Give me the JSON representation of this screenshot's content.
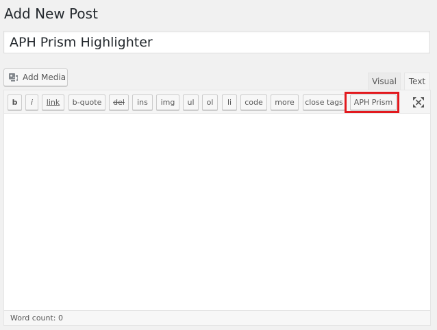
{
  "page": {
    "title": "Add New Post"
  },
  "post": {
    "title_value": "APH Prism Highlighter"
  },
  "media": {
    "add_label": "Add Media",
    "icon": "media-icon"
  },
  "editor_tabs": {
    "visual_label": "Visual",
    "text_label": "Text",
    "active": "Text"
  },
  "quicktags": [
    {
      "id": "b",
      "label": "b"
    },
    {
      "id": "i",
      "label": "i"
    },
    {
      "id": "link",
      "label": "link"
    },
    {
      "id": "b-quote",
      "label": "b-quote"
    },
    {
      "id": "del",
      "label": "del"
    },
    {
      "id": "ins",
      "label": "ins"
    },
    {
      "id": "img",
      "label": "img"
    },
    {
      "id": "ul",
      "label": "ul"
    },
    {
      "id": "ol",
      "label": "ol"
    },
    {
      "id": "li",
      "label": "li"
    },
    {
      "id": "code",
      "label": "code"
    },
    {
      "id": "more",
      "label": "more"
    },
    {
      "id": "close-tags",
      "label": "close tags"
    },
    {
      "id": "aph-prism",
      "label": "APH Prism"
    }
  ],
  "fullscreen": {
    "icon": "fullscreen-icon"
  },
  "editor": {
    "content": ""
  },
  "status": {
    "word_count": "Word count: 0"
  },
  "colors": {
    "highlight": "#e2191e",
    "background": "#f1f1f1",
    "toolbar": "#f5f5f5",
    "text": "#555555"
  }
}
